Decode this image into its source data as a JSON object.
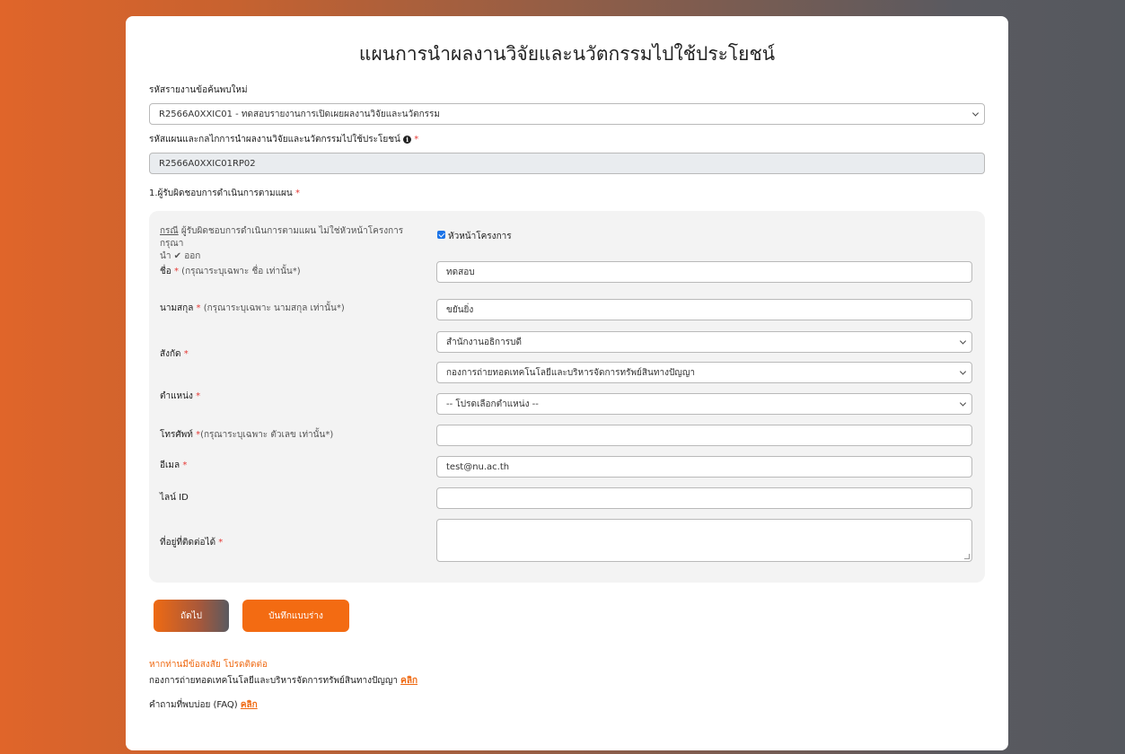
{
  "page_title": "แผนการนำผลงานวิจัยและนวัตกรรมไปใช้ประโยชน์",
  "report_code": {
    "label": "รหัสรายงานข้อค้นพบใหม่",
    "value": "R2566A0XXIC01 - ทดสอบรายงานการเปิดเผยผลงานวิจัยและนวัตกรรม"
  },
  "plan_code": {
    "label": "รหัสแผนและกลไกการนำผลงานวิจัยและนวัตกรรมไปใช้ประโยชน์",
    "required_mark": "*",
    "value": "R2566A0XXIC01RP02"
  },
  "section1": {
    "label": "1.ผู้รับผิดชอบการดำเนินการตามแผน",
    "required_mark": "*"
  },
  "case_note": {
    "prefix": "กรณี",
    "text": " ผู้รับผิดชอบการดำเนินการตามแผน ไม่ใช่หัวหน้าโครงการ กรุณา",
    "text2_a": "นำ",
    "check_glyph": "✔",
    "text2_b": "ออก"
  },
  "head_checkbox": {
    "label": "หัวหน้าโครงการ",
    "checked": true
  },
  "first_name": {
    "label": "ชื่อ",
    "required_mark": "*",
    "hint": "(กรุณาระบุเฉพาะ ชื่อ เท่านั้น*)",
    "value": "ทดสอบ"
  },
  "last_name": {
    "label": "นามสกุล",
    "required_mark": "*",
    "hint": "(กรุณาระบุเฉพาะ นามสกุล เท่านั้น*)",
    "value": "ขยันยิ่ง"
  },
  "affiliation": {
    "label": "สังกัด",
    "required_mark": "*",
    "value1": "สำนักงานอธิการบดี",
    "value2": "กองการถ่ายทอดเทคโนโลยีและบริหารจัดการทรัพย์สินทางปัญญา"
  },
  "position": {
    "label": "ตำแหน่ง",
    "required_mark": "*",
    "value": "-- โปรดเลือกตำแหน่ง --"
  },
  "phone": {
    "label": "โทรศัพท์",
    "required_mark": "*",
    "hint": "(กรุณาระบุเฉพาะ ตัวเลข เท่านั้น*)",
    "value": ""
  },
  "email": {
    "label": "อีเมล",
    "required_mark": "*",
    "value": "test@nu.ac.th"
  },
  "line_id": {
    "label": "ไลน์ ID",
    "value": ""
  },
  "address": {
    "label": "ที่อยู่ที่ติดต่อได้",
    "required_mark": "*",
    "value": ""
  },
  "buttons": {
    "next": "ถัดไป",
    "save_draft": "บันทึกแบบร่าง"
  },
  "contact": {
    "heading": "หากท่านมีข้อสงสัย โปรดติดต่อ",
    "office_text": "กองการถ่ายทอดเทคโนโลยีและบริหารจัดการทรัพย์สินทางปัญญา ",
    "office_link": "คลิก",
    "faq_text": "คำถามที่พบบ่อย (FAQ) ",
    "faq_link": "คลิก"
  },
  "colors": {
    "accent": "#ef6a13",
    "required": "#e53935",
    "checkbox": "#1a73e8",
    "panel": "#f3f3f3"
  }
}
